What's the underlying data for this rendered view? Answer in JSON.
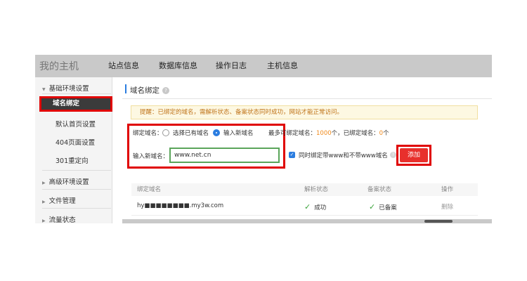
{
  "topnav": {
    "host_title": "我的主机",
    "items": [
      "站点信息",
      "数据库信息",
      "操作日志",
      "主机信息"
    ]
  },
  "sidebar": {
    "group1": "基础环境设置",
    "items": [
      "域名绑定",
      "默认首页设置",
      "404页面设置",
      "301重定向"
    ],
    "active_index": 0,
    "group2": "高级环境设置",
    "group3": "文件管理",
    "group4": "流量状态"
  },
  "main": {
    "section_title": "域名绑定",
    "notice": "提醒：已绑定的域名，需解析状态、备案状态同时成功，网站才能正常访问。",
    "bind_label": "绑定域名：",
    "radio_existing": "选择已有域名",
    "radio_new": "输入新域名",
    "radio_selected": "输入新域名",
    "limit_prefix": "最多可绑定域名：",
    "limit_value": "1000",
    "limit_unit": "个，已绑定域名：",
    "bound_value": "0",
    "bound_unit": "个",
    "input_label": "输入新域名：",
    "input_value": "www.net.cn",
    "checkbox_label": "同时绑定带www和不带www域名",
    "checkbox_checked": true,
    "add_button": "添加"
  },
  "table": {
    "columns": [
      "绑定域名",
      "解析状态",
      "备案状态",
      "操作"
    ],
    "rows": [
      {
        "domain": "hy■■■■■■■■.my3w.com",
        "dns_status": "成功",
        "icp_status": "已备案",
        "action": "删除"
      }
    ]
  },
  "colors": {
    "highlight_red": "#e00000",
    "accent_blue": "#2b7de0",
    "notice_text": "#c0741a",
    "success_green": "#3aa33a"
  }
}
